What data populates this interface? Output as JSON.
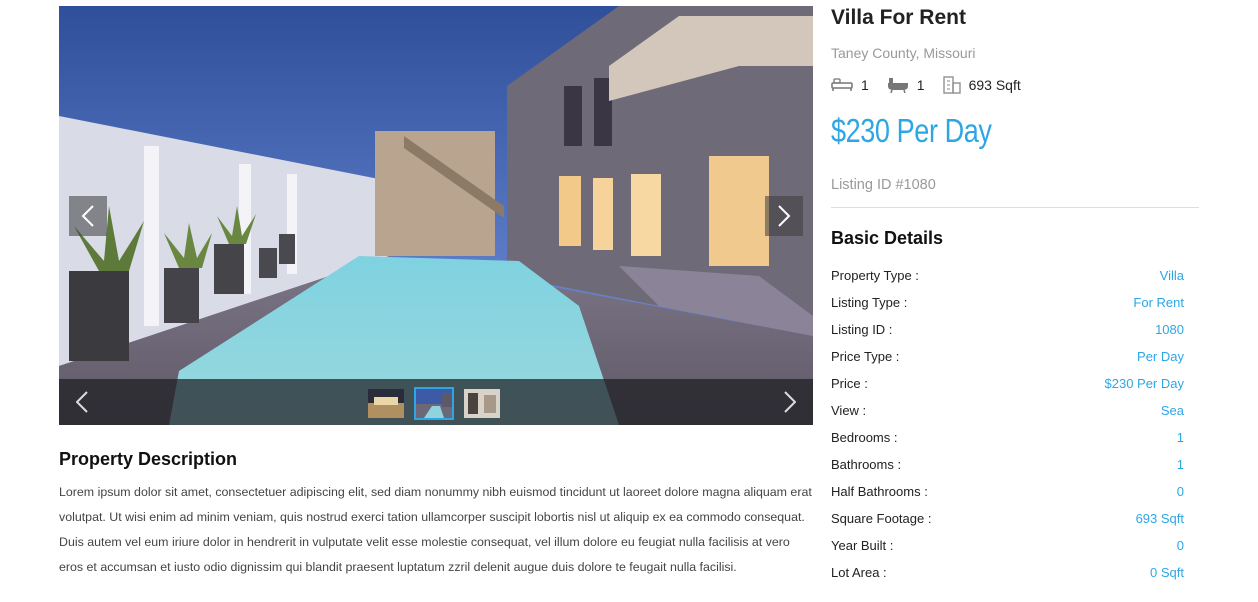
{
  "gallery": {
    "prev_icon": "chevron-left-icon",
    "next_icon": "chevron-right-icon",
    "thumbnails": [
      "thumb-1",
      "thumb-2",
      "thumb-3"
    ],
    "active_thumb": 2
  },
  "description": {
    "title": "Property Description",
    "text": "Lorem ipsum dolor sit amet, consectetuer adipiscing elit, sed diam nonummy nibh euismod tincidunt ut laoreet dolore magna aliquam erat volutpat. Ut wisi enim ad minim veniam, quis nostrud exerci tation ullamcorper suscipit lobortis nisl ut aliquip ex ea commodo consequat. Duis autem vel eum iriure dolor in hendrerit in vulputate velit esse molestie consequat, vel illum dolore eu feugiat nulla facilisis at vero eros et accumsan et iusto odio dignissim qui blandit praesent luptatum zzril delenit augue duis dolore te feugait nulla facilisi."
  },
  "listing": {
    "title": "Villa For Rent",
    "location": "Taney County, Missouri",
    "beds": "1",
    "baths": "1",
    "area": "693 Sqft",
    "price": "$230 Per Day",
    "listing_id": "Listing ID #1080",
    "accent_color": "#2ea6e6"
  },
  "basic_details": {
    "title": "Basic Details",
    "rows": [
      {
        "label": "Property Type :",
        "value": "Villa"
      },
      {
        "label": "Listing Type :",
        "value": "For Rent"
      },
      {
        "label": "Listing ID :",
        "value": "1080"
      },
      {
        "label": "Price Type :",
        "value": "Per Day"
      },
      {
        "label": "Price :",
        "value": "$230 Per Day"
      },
      {
        "label": "View :",
        "value": "Sea"
      },
      {
        "label": "Bedrooms :",
        "value": "1"
      },
      {
        "label": "Bathrooms :",
        "value": "1"
      },
      {
        "label": "Half Bathrooms :",
        "value": "0"
      },
      {
        "label": "Square Footage :",
        "value": "693 Sqft"
      },
      {
        "label": "Year Built :",
        "value": "0"
      },
      {
        "label": "Lot Area :",
        "value": "0 Sqft"
      }
    ]
  }
}
